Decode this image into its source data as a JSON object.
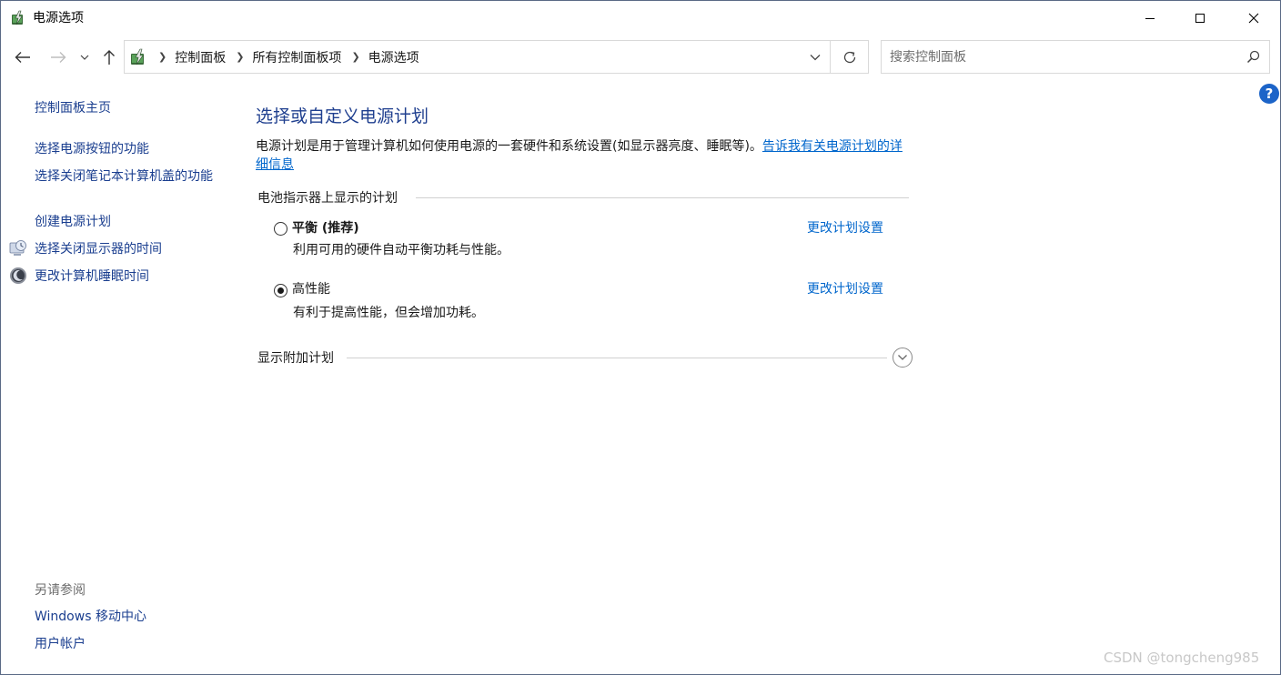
{
  "window": {
    "title": "电源选项"
  },
  "nav": {
    "breadcrumbs": [
      "控制面板",
      "所有控制面板项",
      "电源选项"
    ],
    "search_placeholder": "搜索控制面板"
  },
  "sidebar": {
    "home": "控制面板主页",
    "links": [
      "选择电源按钮的功能",
      "选择关闭笔记本计算机盖的功能",
      "创建电源计划",
      "选择关闭显示器的时间",
      "更改计算机睡眠时间"
    ],
    "see_also_title": "另请参阅",
    "see_also": [
      "Windows 移动中心",
      "用户帐户"
    ]
  },
  "main": {
    "title": "选择或自定义电源计划",
    "description": "电源计划是用于管理计算机如何使用电源的一套硬件和系统设置(如显示器亮度、睡眠等)。",
    "description_link": "告诉我有关电源计划的详细信息",
    "group_header": "电池指示器上显示的计划",
    "plans": [
      {
        "name": "平衡 (推荐)",
        "description": "利用可用的硬件自动平衡功耗与性能。",
        "link": "更改计划设置",
        "selected": false
      },
      {
        "name": "高性能",
        "description": "有利于提高性能，但会增加功耗。",
        "link": "更改计划设置",
        "selected": true
      }
    ],
    "additional_plans": "显示附加计划"
  },
  "help": {
    "label": "?"
  },
  "watermark": "CSDN @tongcheng985",
  "colors": {
    "link": "#0066cc",
    "title": "#1f3f8f",
    "help": "#1c64c8"
  }
}
